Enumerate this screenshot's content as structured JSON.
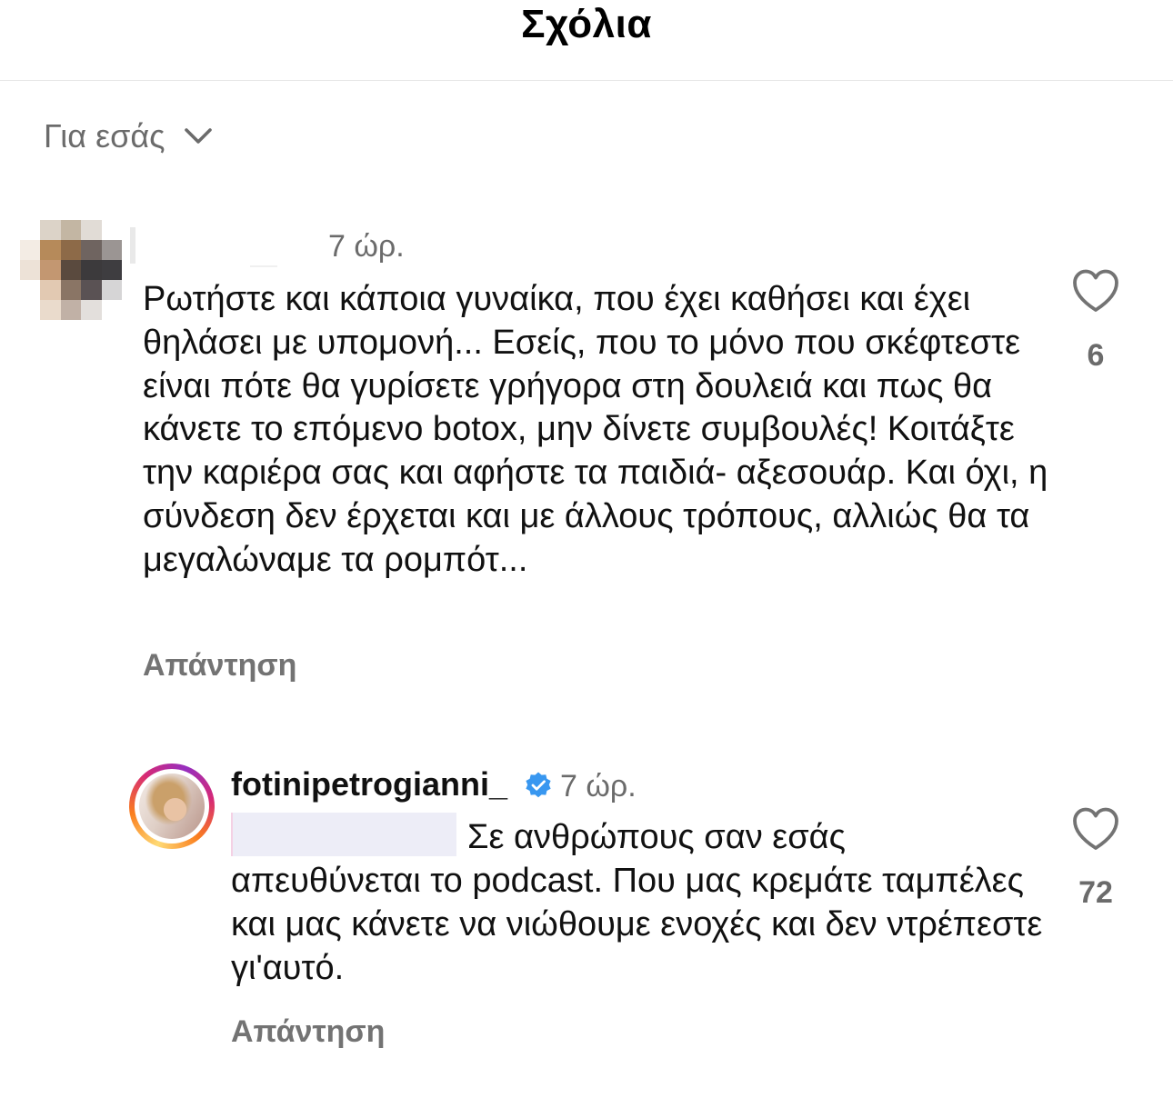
{
  "header": {
    "title": "Σχόλια"
  },
  "sort": {
    "label": "Για εσάς",
    "icon": "chevron-down-icon"
  },
  "comments": [
    {
      "username": "",
      "time": "7 ώρ.",
      "text": "Ρωτήστε και κάποια γυναίκα, που έχει καθήσει και έχει θηλάσει με υπομονή... Εσείς, που το μόνο που σκέφτεστε είναι πότε θα γυρίσετε γρήγορα στη δουλειά και πως θα κάνετε το επόμενο botox, μην δίνετε συμβουλές! Κοιτάξτε την καριέρα σας και αφήστε τα παιδιά- αξεσουάρ. Και όχι, η σύνδεση δεν έρχεται και με άλλους τρόπους, αλλιώς θα τα μεγαλώναμε τα ρομπότ...",
      "likes": "6",
      "reply_label": "Απάντηση"
    },
    {
      "username": "fotinipetrogianni_",
      "verified": true,
      "time": "7 ώρ.",
      "text_line1": "Σε ανθρώπους σαν εσάς",
      "text_rest": "απευθύνεται το podcast. Που μας κρεμάτε ταμπέλες και μας κάνετε να νιώθουμε ενοχές και δεν ντρέπεστε γι'αυτό.",
      "likes": "72",
      "reply_label": "Απάντηση"
    }
  ],
  "colors": {
    "secondary_text": "#6b6b6b",
    "verified_blue": "#3897f0",
    "story_ring": [
      "#feda75",
      "#fa7e1e",
      "#d62976",
      "#962fbf"
    ]
  }
}
